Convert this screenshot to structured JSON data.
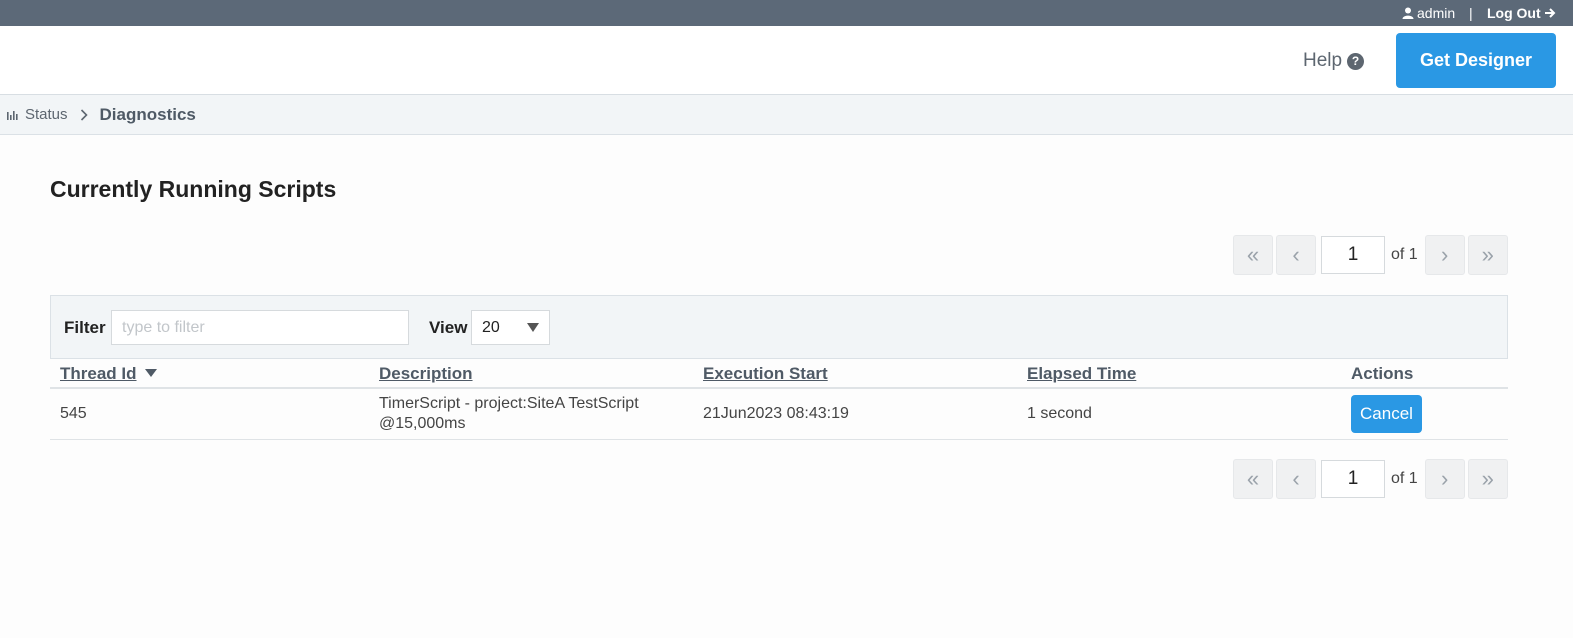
{
  "topbar": {
    "user_name": "admin",
    "separator": "|",
    "logout_label": "Log Out"
  },
  "header": {
    "help_label": "Help",
    "help_icon_glyph": "?",
    "get_designer_label": "Get Designer"
  },
  "breadcrumb": {
    "parent_label": "Status",
    "current_label": "Diagnostics"
  },
  "page": {
    "title": "Currently Running Scripts"
  },
  "pagination": {
    "first": "«",
    "prev": "‹",
    "next": "›",
    "last": "»",
    "current_page": "1",
    "of_label": "of 1"
  },
  "filter": {
    "label": "Filter",
    "placeholder": "type to filter",
    "view_label": "View",
    "view_value": "20"
  },
  "table": {
    "columns": [
      "Thread Id",
      "Description",
      "Execution Start",
      "Elapsed Time",
      "Actions"
    ],
    "sort_column": "Thread Id",
    "sort_direction": "descending",
    "rows": [
      {
        "thread_id": "545",
        "description_line1": "TimerScript - project:SiteA TestScript",
        "description_line2": "@15,000ms",
        "execution_start": "21Jun2023 08:43:19",
        "elapsed_time": "1 second",
        "action_label": "Cancel"
      }
    ]
  },
  "colors": {
    "topbar": "#5c6978",
    "accent_blue": "#2a98e4",
    "panel_bg": "#f2f5f7"
  }
}
